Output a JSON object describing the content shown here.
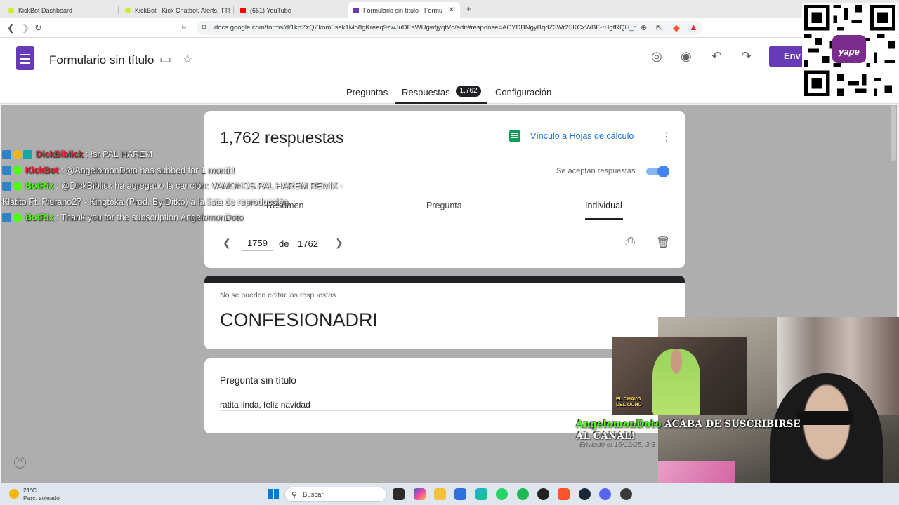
{
  "browser": {
    "tabs": [
      {
        "label": "KickBot Dashboard",
        "color": "#c8f01e"
      },
      {
        "label": "KickBot - Kick Chatbot, Alerts, TTS, C",
        "color": "#c8f01e"
      },
      {
        "label": "(651) YouTube",
        "color": "#ff0000"
      },
      {
        "label": "Formulario sin título - Formulari",
        "color": "#673ab7",
        "active": true
      }
    ],
    "url": "docs.google.com/forms/d/1krfZzQZkom5sek1Mo8gKreeq9zwJuDEsWUgwfjyqtVc/edit#response=ACYDBNgyBqdZ3Wr25KCxWBF-rHgfRQH_mK..."
  },
  "header": {
    "title": "Formulario sin título",
    "send_label": "Env",
    "tabs": [
      "Preguntas",
      "Respuestas",
      "Configuración"
    ],
    "responses_badge": "1,762"
  },
  "summary": {
    "count_title": "1,762 respuestas",
    "sheets_link": "Vínculo a Hojas de cálculo",
    "accept_label": "Se aceptan respuestas",
    "accepting": true,
    "view_tabs": [
      "Resumen",
      "Pregunta",
      "Individual"
    ],
    "pager_current": "1759",
    "pager_of": "de",
    "pager_total": "1762"
  },
  "response": {
    "note": "No se pueden editar las respuestas",
    "title": "CONFESIONADRI",
    "question": "Pregunta sin título",
    "answer": "ratita linda, feliz navidad",
    "sent": "Enviado el 16/12/25, 3:3"
  },
  "chat": [
    {
      "user": "DickBiblick",
      "user_color": "#e0202d",
      "text": ": !sr PAL HAREM"
    },
    {
      "user": "KickBot",
      "user_color": "#e0202d",
      "text": ": @AngelomonDoto has subbed for 1 month!"
    },
    {
      "user": "BotRix",
      "user_color": "#53fc18",
      "text": ": @DickBiblick ha agregado la canción: VAMONOS PAL HAREM REMIX - Klatito Ft. Piurano27 - Kingteka (Prod. By Ditko) a la lista de reproducción."
    },
    {
      "user": "BotRix",
      "user_color": "#53fc18",
      "text": ": Thank you for the subscription AngelomonDoto"
    }
  ],
  "overlay": {
    "qr_brand": "yape",
    "alert_name": "AngelomonDoto",
    "alert_text": " ACABA DE SUSCRIBIRSE AL CANAL!",
    "clip_logo": "EL CHAVO DEL OCHO"
  },
  "taskbar": {
    "temp": "21°C",
    "weather": "Parc. soleado",
    "search_placeholder": "Buscar"
  }
}
